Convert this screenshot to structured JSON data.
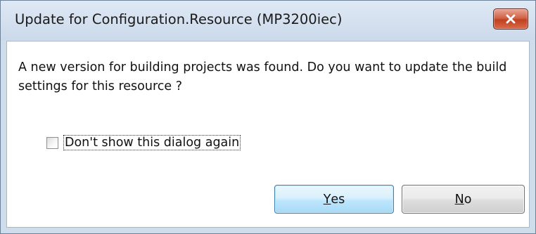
{
  "window": {
    "title": "Update for Configuration.Resource (MP3200iec)"
  },
  "message": {
    "text": "A new version for building projects was found. Do you want to update the build settings for this resource ?"
  },
  "checkbox": {
    "label": "Don't show this dialog again",
    "checked": false
  },
  "buttons": {
    "yes": {
      "mnemonic": "Y",
      "rest": "es"
    },
    "no": {
      "mnemonic": "N",
      "rest": "o"
    }
  },
  "icons": {
    "close": "close-icon"
  },
  "colors": {
    "close_button": "#c94a2c",
    "default_button_border": "#3c7fb1",
    "frame": "#cfdcea"
  }
}
